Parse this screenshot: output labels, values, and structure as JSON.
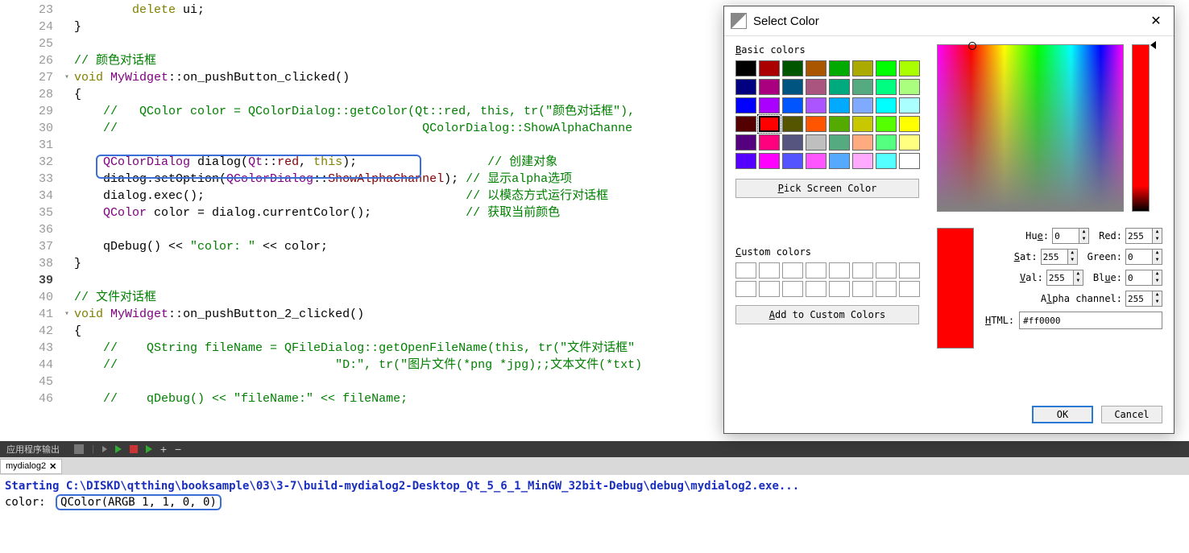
{
  "lines": [
    {
      "n": 23,
      "html": "        <span class='kw'>delete</span> ui;"
    },
    {
      "n": 24,
      "html": "}"
    },
    {
      "n": 25,
      "html": ""
    },
    {
      "n": 26,
      "html": "<span class='cm'>// 颜色对话框</span>"
    },
    {
      "n": 27,
      "html": "<span class='kw'>void</span> <span class='ty'>MyWidget</span>::<span class='fn'>on_pushButton_clicked</span>()",
      "fold": "▾"
    },
    {
      "n": 28,
      "html": "{"
    },
    {
      "n": 29,
      "html": "    <span class='cm'>//   QColor color = QColorDialog::getColor(Qt::red, this, tr(\"颜色对话框\"),</span>"
    },
    {
      "n": 30,
      "html": "    <span class='cm'>//                                          QColorDialog::ShowAlphaChanne</span>"
    },
    {
      "n": 31,
      "html": ""
    },
    {
      "n": 32,
      "html": "    <span class='ty'>QColorDialog</span> dialog(<span class='ty'>Qt</span>::<span class='en'>red</span>, <span class='kw'>this</span>);                  <span class='cm'>// 创建对象</span>"
    },
    {
      "n": 33,
      "html": "    dialog.setOption(<span class='ty'>QColorDialog</span>::<span class='en'>ShowAlphaChannel</span>); <span class='cm'>// 显示alpha选项</span>"
    },
    {
      "n": 34,
      "html": "    dialog.exec();                                    <span class='cm'>// 以模态方式运行对话框</span>"
    },
    {
      "n": 35,
      "html": "    <span class='ty'>QColor</span> color = dialog.currentColor();             <span class='cm'>// 获取当前颜色</span>"
    },
    {
      "n": 36,
      "html": ""
    },
    {
      "n": 37,
      "html": "    qDebug() &lt;&lt; <span class='st'>\"color: \"</span> &lt;&lt; color;"
    },
    {
      "n": 38,
      "html": "}"
    },
    {
      "n": 39,
      "html": "",
      "cur": true
    },
    {
      "n": 40,
      "html": "<span class='cm'>// 文件对话框</span>"
    },
    {
      "n": 41,
      "html": "<span class='kw'>void</span> <span class='ty'>MyWidget</span>::<span class='fn'>on_pushButton_2_clicked</span>()",
      "fold": "▾"
    },
    {
      "n": 42,
      "html": "{"
    },
    {
      "n": 43,
      "html": "    <span class='cm'>//    QString fileName = QFileDialog::getOpenFileName(this, tr(\"文件对话框\"</span>"
    },
    {
      "n": 44,
      "html": "    <span class='cm'>//                              \"D:\", tr(\"图片文件(*png *jpg);;文本文件(*txt)</span>"
    },
    {
      "n": 45,
      "html": ""
    },
    {
      "n": 46,
      "html": "    <span class='cm'>//    qDebug() &lt;&lt; \"fileName:\" &lt;&lt; fileName;</span>"
    }
  ],
  "bottomBar": {
    "label": "应用程序输出"
  },
  "tab": {
    "name": "mydialog2",
    "close": "✕"
  },
  "console": {
    "line1": "Starting C:\\DISKD\\qtthing\\booksample\\03\\3-7\\build-mydialog2-Desktop_Qt_5_6_1_MinGW_32bit-Debug\\debug\\mydialog2.exe...",
    "line2a": "color: ",
    "line2b": "QColor(ARGB 1, 1, 0, 0)"
  },
  "dialog": {
    "title": "Select Color",
    "basicLabel": "Basic colors",
    "pickBtn": "Pick Screen Color",
    "customLabel": "Custom colors",
    "addBtn": "Add to Custom Colors",
    "hue": {
      "label": "Hue:",
      "val": "0"
    },
    "sat": {
      "label": "Sat:",
      "val": "255"
    },
    "val": {
      "label": "Val:",
      "val": "255"
    },
    "red": {
      "label": "Red:",
      "val": "255"
    },
    "green": {
      "label": "Green:",
      "val": "0"
    },
    "blue": {
      "label": "Blue:",
      "val": "0"
    },
    "alpha": {
      "label": "Alpha channel:",
      "val": "255"
    },
    "htmlLabel": "HTML:",
    "htmlVal": "#ff0000",
    "ok": "OK",
    "cancel": "Cancel"
  },
  "basicColors": [
    "#000000",
    "#aa0000",
    "#005500",
    "#aa5500",
    "#00aa00",
    "#aaaa00",
    "#00ff00",
    "#aaff00",
    "#000080",
    "#aa007f",
    "#005580",
    "#aa557f",
    "#00aa7f",
    "#55aa7f",
    "#00ff80",
    "#aaff7f",
    "#0000ff",
    "#aa00ff",
    "#0055ff",
    "#aa55ff",
    "#00aaff",
    "#80aaff",
    "#00ffff",
    "#aaffff",
    "#550000",
    "#ff0000",
    "#555500",
    "#ff5500",
    "#55aa00",
    "#c8c800",
    "#55ff00",
    "#ffff00",
    "#55007f",
    "#ff007f",
    "#55557f",
    "#bfbfbf",
    "#55aa7f",
    "#ffaa7f",
    "#55ff80",
    "#ffff80",
    "#5500ff",
    "#ff00ff",
    "#5555ff",
    "#ff55ff",
    "#55aaff",
    "#ffaaff",
    "#55ffff",
    "#ffffff"
  ],
  "selectedSwatch": 25
}
